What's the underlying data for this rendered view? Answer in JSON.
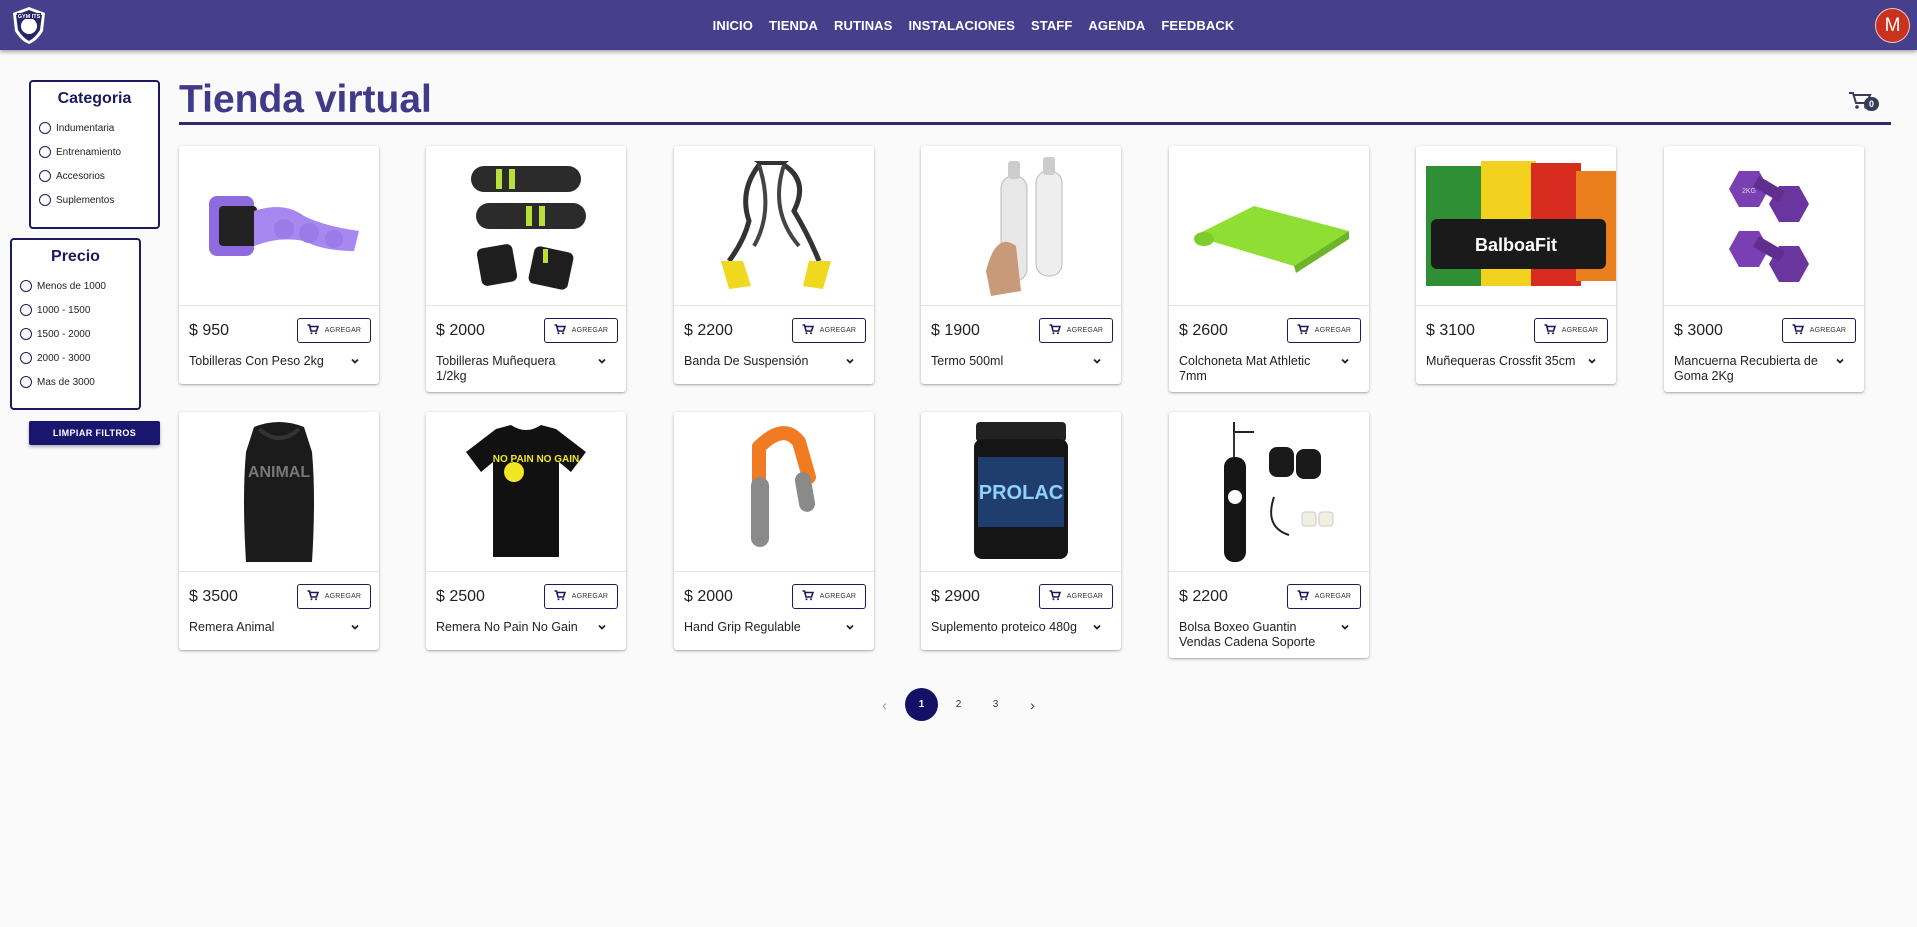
{
  "header": {
    "logo_text": "GYM ITS",
    "nav": [
      "INICIO",
      "TIENDA",
      "RUTINAS",
      "INSTALACIONES",
      "STAFF",
      "AGENDA",
      "FEEDBACK"
    ],
    "avatar_initial": "M"
  },
  "sidebar": {
    "category_title": "Categoria",
    "categories": [
      "Indumentaria",
      "Entrenamiento",
      "Accesorios",
      "Suplementos"
    ],
    "price_title": "Precio",
    "prices": [
      "Menos de 1000",
      "1000 - 1500",
      "1500 - 2000",
      "2000 - 3000",
      "Mas de 3000"
    ],
    "clear_label": "LIMPIAR FILTROS"
  },
  "main": {
    "title": "Tienda virtual",
    "cart_count": "0",
    "add_label": "AGREGAR",
    "products": [
      {
        "price": "$ 950",
        "name": "Tobilleras Con Peso 2kg",
        "icon": "ankle-weights"
      },
      {
        "price": "$ 2000",
        "name": "Tobilleras Muñequera 1/2kg",
        "icon": "wrist-weights"
      },
      {
        "price": "$ 2200",
        "name": "Banda De Suspensión",
        "icon": "suspension-trainer"
      },
      {
        "price": "$ 1900",
        "name": "Termo 500ml",
        "icon": "bottles"
      },
      {
        "price": "$ 2600",
        "name": "Colchoneta Mat Athletic 7mm",
        "icon": "yoga-mat"
      },
      {
        "price": "$ 3100",
        "name": "Muñequeras Crossfit 35cm",
        "icon": "wrist-wraps",
        "image_text": "BalboaFit"
      },
      {
        "price": "$ 3000",
        "name": "Mancuerna Recubierta de Goma 2Kg",
        "icon": "dumbbells",
        "image_text": "2KG"
      },
      {
        "price": "$ 3500",
        "name": "Remera Animal",
        "icon": "tank-top",
        "image_text": "ANIMAL"
      },
      {
        "price": "$ 2500",
        "name": "Remera No Pain No Gain",
        "icon": "tshirt",
        "image_text": "NO PAIN NO GAIN"
      },
      {
        "price": "$ 2000",
        "name": "Hand Grip Regulable",
        "icon": "hand-grip"
      },
      {
        "price": "$ 2900",
        "name": "Suplemento proteico 480g",
        "icon": "protein-tub",
        "image_text": "PROLAC"
      },
      {
        "price": "$ 2200",
        "name": "Bolsa Boxeo Guantin Vendas Cadena Soporte",
        "icon": "boxing-bag"
      }
    ]
  },
  "pagination": {
    "prev": "‹",
    "pages": [
      "1",
      "2",
      "3"
    ],
    "current": "1",
    "next": "›"
  },
  "colors": {
    "header": "#463f8c",
    "accent": "#1c1a5e",
    "title": "#413a88",
    "avatar": "#c8321e"
  }
}
